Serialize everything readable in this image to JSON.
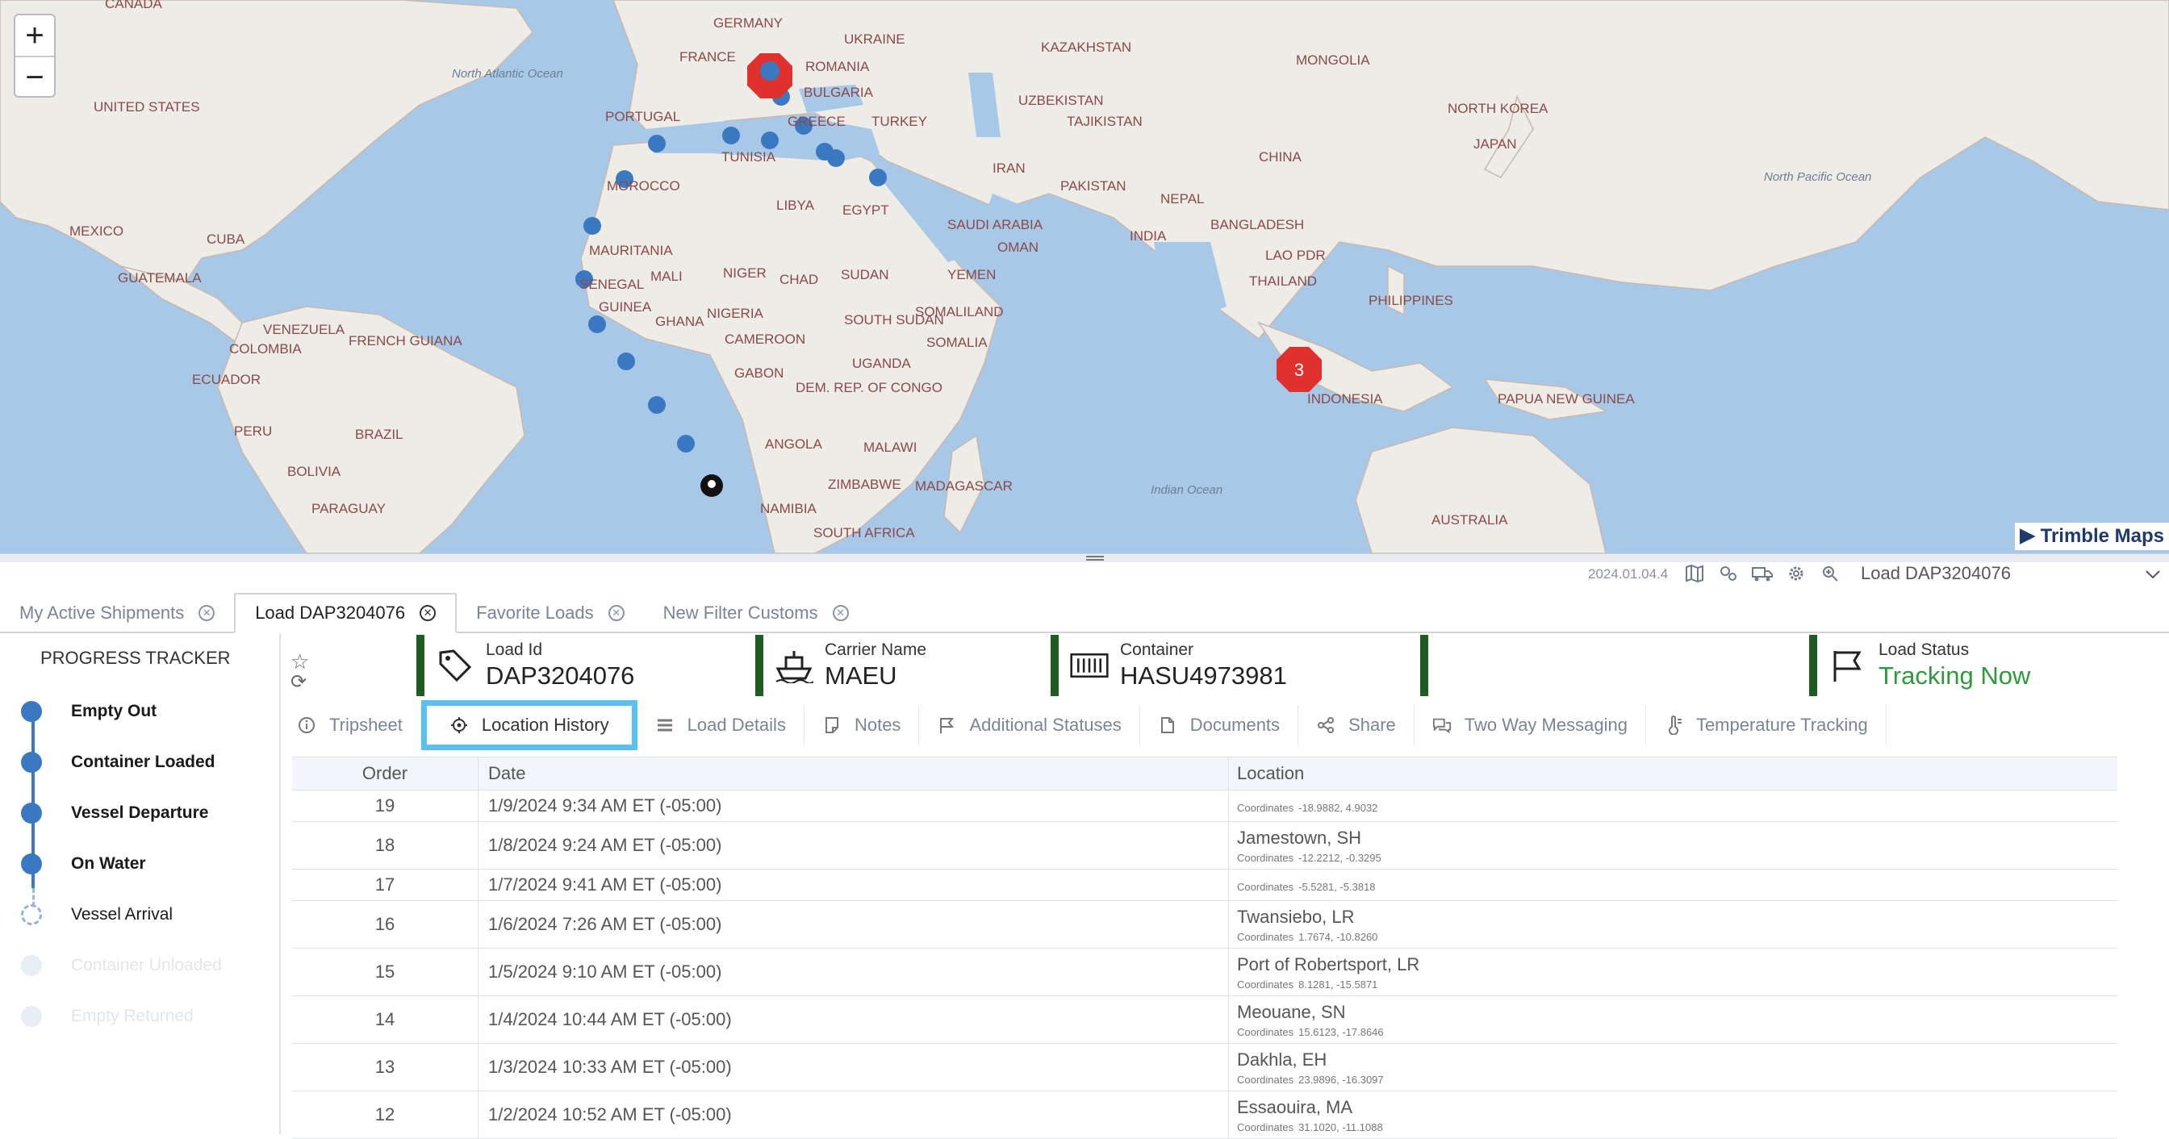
{
  "map": {
    "zoom_in": "+",
    "zoom_out": "−",
    "attribution": "Trimble Maps",
    "labels": {
      "ocean_north_atlantic": "North Atlantic Ocean",
      "ocean_indian": "Indian Ocean",
      "ocean_north_pacific": "North Pacific Ocean",
      "canada": "CANADA",
      "united_states": "UNITED STATES",
      "mexico": "MEXICO",
      "cuba": "CUBA",
      "guatemala": "GUATEMALA",
      "venezuela": "VENEZUELA",
      "colombia": "COLOMBIA",
      "french_guiana": "FRENCH GUIANA",
      "ecuador": "ECUADOR",
      "peru": "PERU",
      "brazil": "BRAZIL",
      "bolivia": "BOLIVIA",
      "paraguay": "PARAGUAY",
      "germany": "GERMANY",
      "france": "FRANCE",
      "ukraine": "UKRAINE",
      "romania": "ROMANIA",
      "bulgaria": "BULGARIA",
      "portugal": "PORTUGAL",
      "greece": "GREECE",
      "turkey": "TURKEY",
      "tunisia": "TUNISIA",
      "morocco": "MOROCCO",
      "libya": "LIBYA",
      "egypt": "EGYPT",
      "kazakhstan": "KAZAKHSTAN",
      "mongolia": "MONGOLIA",
      "uzbekistan": "UZBEKISTAN",
      "tajikistan": "TAJIKISTAN",
      "north_korea": "NORTH KOREA",
      "japan": "JAPAN",
      "china": "CHINA",
      "iran": "IRAN",
      "pakistan": "PAKISTAN",
      "nepal": "NEPAL",
      "india": "INDIA",
      "bangladesh": "BANGLADESH",
      "saudi_arabia": "SAUDI ARABIA",
      "oman": "OMAN",
      "yemen": "YEMEN",
      "lao_pdr": "LAO PDR",
      "thailand": "THAILAND",
      "philippines": "PHILIPPINES",
      "mauritania": "MAURITANIA",
      "mali": "MALI",
      "niger": "NIGER",
      "chad": "CHAD",
      "sudan": "SUDAN",
      "senegal": "SENEGAL",
      "guinea": "GUINEA",
      "ghana": "GHANA",
      "nigeria": "NIGERIA",
      "cameroon": "CAMEROON",
      "somaliland": "SOMALILAND",
      "south_sudan": "SOUTH SUDAN",
      "somalia": "SOMALIA",
      "gabon": "GABON",
      "uganda": "UGANDA",
      "dem_rep_congo": "DEM. REP. OF CONGO",
      "angola": "ANGOLA",
      "malawi": "MALAWI",
      "zimbabwe": "ZIMBABWE",
      "madagascar": "MADAGASCAR",
      "namibia": "NAMIBIA",
      "south_africa": "SOUTH AFRICA",
      "indonesia": "INDONESIA",
      "papua_new_guinea": "PAPUA NEW GUINEA",
      "australia": "AUSTRALIA"
    },
    "cluster_count": "3"
  },
  "topbar": {
    "version": "2024.01.04.4",
    "load_selector": "Load DAP3204076",
    "icons": [
      "map-icon",
      "settings-cluster-icon",
      "truck-icon",
      "gear-icon",
      "zoom-icon"
    ]
  },
  "tabs": [
    {
      "label": "My Active Shipments",
      "active": false
    },
    {
      "label": "Load DAP3204076",
      "active": true
    },
    {
      "label": "Favorite Loads",
      "active": false
    },
    {
      "label": "New Filter Customs",
      "active": false
    }
  ],
  "tracker": {
    "title": "PROGRESS TRACKER",
    "steps": [
      {
        "label": "Empty Out",
        "state": "done"
      },
      {
        "label": "Container Loaded",
        "state": "done"
      },
      {
        "label": "Vessel Departure",
        "state": "done"
      },
      {
        "label": "On Water",
        "state": "done"
      },
      {
        "label": "Vessel Arrival",
        "state": "current"
      },
      {
        "label": "Container Unloaded",
        "state": "future"
      },
      {
        "label": "Empty Returned",
        "state": "future"
      }
    ]
  },
  "summary": {
    "load_id_label": "Load Id",
    "load_id": "DAP3204076",
    "carrier_label": "Carrier Name",
    "carrier": "MAEU",
    "container_label": "Container",
    "container": "HASU4973981",
    "status_label": "Load Status",
    "status": "Tracking Now",
    "status_color": "#2e9a3d",
    "card_accent": "#1f5c1f"
  },
  "detail_tabs": [
    {
      "label": "Tripsheet",
      "icon": "info-icon"
    },
    {
      "label": "Location History",
      "icon": "location-target-icon",
      "active": true
    },
    {
      "label": "Load Details",
      "icon": "list-icon"
    },
    {
      "label": "Notes",
      "icon": "note-icon"
    },
    {
      "label": "Additional Statuses",
      "icon": "flag-icon"
    },
    {
      "label": "Documents",
      "icon": "document-icon"
    },
    {
      "label": "Share",
      "icon": "share-icon"
    },
    {
      "label": "Two Way Messaging",
      "icon": "chat-icon"
    },
    {
      "label": "Temperature Tracking",
      "icon": "thermometer-icon"
    }
  ],
  "history": {
    "headers": {
      "order": "Order",
      "date": "Date",
      "location": "Location"
    },
    "coords_label": "Coordinates",
    "rows": [
      {
        "order": "19",
        "date": "1/9/2024  9:34 AM  ET (-05:00)",
        "location": "",
        "coords": "-18.9882, 4.9032"
      },
      {
        "order": "18",
        "date": "1/8/2024  9:24 AM  ET (-05:00)",
        "location": "Jamestown, SH",
        "coords": "-12.2212, -0.3295"
      },
      {
        "order": "17",
        "date": "1/7/2024  9:41 AM  ET (-05:00)",
        "location": "",
        "coords": "-5.5281, -5.3818"
      },
      {
        "order": "16",
        "date": "1/6/2024  7:26 AM  ET (-05:00)",
        "location": "Twansiebo, LR",
        "coords": "1.7674, -10.8260"
      },
      {
        "order": "15",
        "date": "1/5/2024  9:10 AM  ET (-05:00)",
        "location": "Port of Robertsport, LR",
        "coords": "8.1281, -15.5871"
      },
      {
        "order": "14",
        "date": "1/4/2024  10:44 AM  ET (-05:00)",
        "location": "Meouane, SN",
        "coords": "15.6123, -17.8646"
      },
      {
        "order": "13",
        "date": "1/3/2024  10:33 AM  ET (-05:00)",
        "location": "Dakhla, EH",
        "coords": "23.9896, -16.3097"
      },
      {
        "order": "12",
        "date": "1/2/2024  10:52 AM  ET (-05:00)",
        "location": "Essaouira, MA",
        "coords": "31.1020, -11.1088"
      }
    ]
  }
}
